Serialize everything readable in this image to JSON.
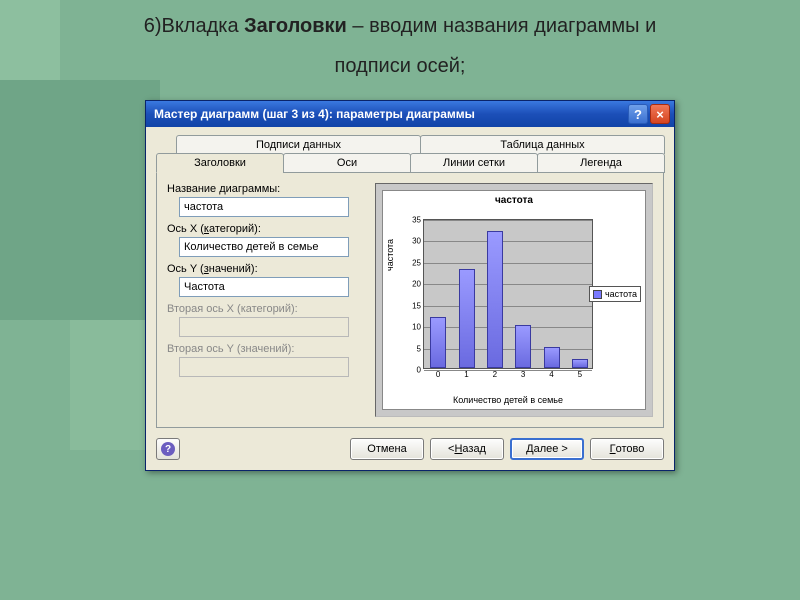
{
  "slide": {
    "caption_prefix": "6)Вкладка ",
    "caption_bold": "Заголовки",
    "caption_suffix": " – вводим названия диаграммы и",
    "caption_line2": "подписи осей;"
  },
  "window": {
    "title": "Мастер диаграмм (шаг 3 из 4): параметры диаграммы",
    "help_glyph": "?",
    "close_glyph": "×"
  },
  "tabs": {
    "row1": [
      "Подписи данных",
      "Таблица данных"
    ],
    "row2": [
      "Заголовки",
      "Оси",
      "Линии сетки",
      "Легенда"
    ],
    "active": "Заголовки"
  },
  "form": {
    "chart_title_label": "Название диаграммы:",
    "chart_title_value": "частота",
    "x_axis_label": "Ось X (категорий):",
    "x_axis_hotkey": "к",
    "x_axis_value": "Количество детей в семье",
    "y_axis_label": "Ось Y (значений):",
    "y_axis_hotkey": "з",
    "y_axis_value": "Частота",
    "x2_axis_label": "Вторая ось X (категорий):",
    "x2_axis_value": "",
    "y2_axis_label": "Вторая ось Y (значений):",
    "y2_axis_value": ""
  },
  "chart_data": {
    "type": "bar",
    "title": "частота",
    "xlabel": "Количество детей в семье",
    "ylabel": "частота",
    "categories": [
      "0",
      "1",
      "2",
      "3",
      "4",
      "5"
    ],
    "values": [
      12,
      23,
      32,
      10,
      5,
      2
    ],
    "ylim": [
      0,
      35
    ],
    "yticks": [
      0,
      5,
      10,
      15,
      20,
      25,
      30,
      35
    ],
    "legend": "частота"
  },
  "buttons": {
    "help_glyph": "?",
    "cancel": "Отмена",
    "back": "< Назад",
    "back_hotkey": "Н",
    "next": "Далее >",
    "next_hotkey": "Д",
    "finish": "Готово",
    "finish_hotkey": "Г"
  }
}
